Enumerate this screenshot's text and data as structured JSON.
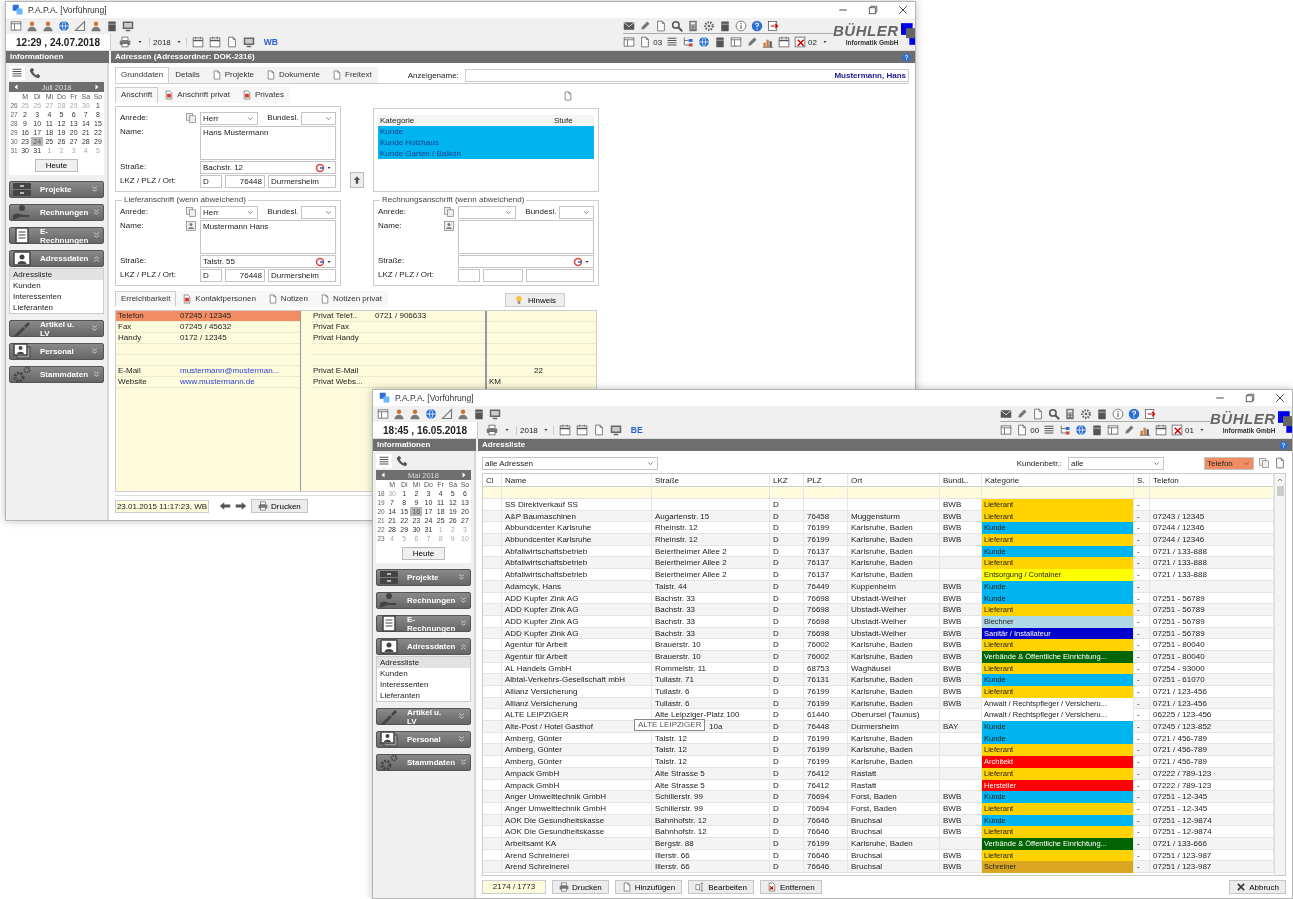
{
  "windows": [
    {
      "kind": "address_form",
      "title": "P.A.P.A. [Vorführung]",
      "clock": "12:29 , 24.07.2018",
      "year": "2018",
      "user": "WB",
      "counter_a": "03",
      "counter_b": "02",
      "logo": {
        "name": "BÜHLER",
        "sub": "Informatik GmbH"
      },
      "side_header": "Informationen",
      "main_header": "Adressen (Adressordner: DOK-2316)",
      "calendar": {
        "month": "Juli 2018",
        "weekdays": [
          "M",
          "Di",
          "Mi",
          "Do",
          "Fr",
          "Sa",
          "So"
        ],
        "weeks": [
          {
            "week": "26",
            "days": [
              {
                "d": "25",
                "muted": true,
                "selected": false
              },
              {
                "d": "26",
                "muted": true,
                "selected": false
              },
              {
                "d": "27",
                "muted": true,
                "selected": false
              },
              {
                "d": "28",
                "muted": true,
                "selected": false
              },
              {
                "d": "29",
                "muted": true,
                "selected": false
              },
              {
                "d": "30",
                "muted": true,
                "selected": false
              },
              {
                "d": "1",
                "muted": false,
                "selected": false
              }
            ]
          },
          {
            "week": "27",
            "days": [
              {
                "d": "2",
                "muted": false,
                "selected": false
              },
              {
                "d": "3",
                "muted": false,
                "selected": false
              },
              {
                "d": "4",
                "muted": false,
                "selected": false
              },
              {
                "d": "5",
                "muted": false,
                "selected": false
              },
              {
                "d": "6",
                "muted": false,
                "selected": false
              },
              {
                "d": "7",
                "muted": false,
                "selected": false
              },
              {
                "d": "8",
                "muted": false,
                "selected": false
              }
            ]
          },
          {
            "week": "28",
            "days": [
              {
                "d": "9",
                "muted": false,
                "selected": false
              },
              {
                "d": "10",
                "muted": false,
                "selected": false
              },
              {
                "d": "11",
                "muted": false,
                "selected": false
              },
              {
                "d": "12",
                "muted": false,
                "selected": false
              },
              {
                "d": "13",
                "muted": false,
                "selected": false
              },
              {
                "d": "14",
                "muted": false,
                "selected": false
              },
              {
                "d": "15",
                "muted": false,
                "selected": false
              }
            ]
          },
          {
            "week": "29",
            "days": [
              {
                "d": "16",
                "muted": false,
                "selected": false
              },
              {
                "d": "17",
                "muted": false,
                "selected": false
              },
              {
                "d": "18",
                "muted": false,
                "selected": false
              },
              {
                "d": "19",
                "muted": false,
                "selected": false
              },
              {
                "d": "20",
                "muted": false,
                "selected": false
              },
              {
                "d": "21",
                "muted": false,
                "selected": false
              },
              {
                "d": "22",
                "muted": false,
                "selected": false
              }
            ]
          },
          {
            "week": "30",
            "days": [
              {
                "d": "23",
                "muted": false,
                "selected": false
              },
              {
                "d": "24",
                "muted": false,
                "selected": true
              },
              {
                "d": "25",
                "muted": false,
                "selected": false
              },
              {
                "d": "26",
                "muted": false,
                "selected": false
              },
              {
                "d": "27",
                "muted": false,
                "selected": false
              },
              {
                "d": "28",
                "muted": false,
                "selected": false
              },
              {
                "d": "29",
                "muted": false,
                "selected": false
              }
            ]
          },
          {
            "week": "31",
            "days": [
              {
                "d": "30",
                "muted": false,
                "selected": false
              },
              {
                "d": "31",
                "muted": false,
                "selected": false
              },
              {
                "d": "1",
                "muted": true,
                "selected": false
              },
              {
                "d": "2",
                "muted": true,
                "selected": false
              },
              {
                "d": "3",
                "muted": true,
                "selected": false
              },
              {
                "d": "4",
                "muted": true,
                "selected": false
              },
              {
                "d": "5",
                "muted": true,
                "selected": false
              }
            ]
          }
        ]
      },
      "today": "Heute",
      "nav": [
        {
          "label": "Projekte",
          "expanded": false
        },
        {
          "label": "Rechnungen",
          "expanded": false
        },
        {
          "label": "E-Rechnungen",
          "expanded": false
        },
        {
          "label": "Adressdaten",
          "expanded": true,
          "items": [
            {
              "label": "Adressliste",
              "selected": true
            },
            {
              "label": "Kunden",
              "selected": false
            },
            {
              "label": "Interessenten",
              "selected": false
            },
            {
              "label": "Lieferanten",
              "selected": false
            }
          ]
        },
        {
          "label": "Artikel u. LV",
          "expanded": false
        },
        {
          "label": "Personal",
          "expanded": false
        },
        {
          "label": "Stammdaten",
          "expanded": false
        }
      ],
      "main": {
        "tabs": [
          {
            "label": "Grunddaten",
            "selected": true,
            "kind": "plain"
          },
          {
            "label": "Details",
            "selected": false,
            "kind": "plain"
          },
          {
            "label": "Projekte",
            "selected": false,
            "kind": "icon"
          },
          {
            "label": "Dokumente",
            "selected": false,
            "kind": "icon"
          },
          {
            "label": "Freitext",
            "selected": false,
            "kind": "icon"
          }
        ],
        "display_name": {
          "label": "Anzeigename:",
          "value": "Mustermann, Hans"
        },
        "subtabs": [
          {
            "label": "Anschrift",
            "selected": true,
            "kind": "plain"
          },
          {
            "label": "Anschrift privat",
            "selected": false,
            "kind": "icon"
          },
          {
            "label": "Privates",
            "selected": false,
            "kind": "icon"
          }
        ],
        "address": {
          "kind": "primary",
          "labels": {
            "salutation": "Anrede:",
            "state": "Bundesl.",
            "name": "Name:",
            "street": "Straße:",
            "location": "LKZ / PLZ / Ort:"
          },
          "salutation": "Herr",
          "name": "Hans Mustermann",
          "street": "Bachstr. 12",
          "country": "D",
          "zip": "76448",
          "city": "Durmersheim"
        },
        "categories": {
          "columns": [
            "Kategorie",
            "Stufe"
          ],
          "rows": [
            {
              "label": "Kunde",
              "selected": true
            },
            {
              "label": "Kunde Holzhaus",
              "selected": true
            },
            {
              "label": "Kunde Garten / Balkon",
              "selected": true
            }
          ]
        },
        "delivery": {
          "kind": "alternate",
          "title": "Lieferanschrift (wenn abweichend)",
          "labels": {
            "salutation": "Anrede:",
            "state": "Bundesl.",
            "name": "Name:",
            "street": "Straße:",
            "location": "LKZ / PLZ / Ort:"
          },
          "salutation": "Herr",
          "name": "Mustermann Hans",
          "street": "Talstr. 55",
          "country": "D",
          "zip": "76448",
          "city": "Durmersheim"
        },
        "billing": {
          "kind": "alternate",
          "title": "Rechnungsanschrift (wenn abweichend)",
          "labels": {
            "salutation": "Anrede:",
            "state": "Bundesl.",
            "name": "Name:",
            "street": "Straße:",
            "location": "LKZ / PLZ / Ort:"
          }
        },
        "contact_tabs": [
          {
            "label": "Erreichbarkeit",
            "selected": true,
            "kind": "plain"
          },
          {
            "label": "Kontaktpersonen",
            "selected": false,
            "kind": "icon"
          },
          {
            "label": "Notizen",
            "selected": false,
            "kind": "icon"
          },
          {
            "label": "Notizen privat",
            "selected": false,
            "kind": "icon"
          }
        ],
        "hint_button": "Hinweis",
        "contacts": [
          {
            "label": "Telefon",
            "value": "07245 / 12345",
            "selected": true,
            "kind": "text",
            "private_label": "Privat Telef..",
            "private_value": "0721 / 906633"
          },
          {
            "label": "Fax",
            "value": "07245 / 45632",
            "selected": false,
            "kind": "text",
            "private_label": "Privat Fax"
          },
          {
            "label": "Handy",
            "value": "0172 / 12345",
            "selected": false,
            "kind": "text",
            "private_label": "Privat Handy"
          },
          {
            "selected": false,
            "kind": "blank"
          },
          {
            "selected": false,
            "kind": "blank"
          },
          {
            "label": "E-Mail",
            "value": "mustermann@musterman...",
            "selected": false,
            "kind": "link",
            "private_label": "Privat E-Mail",
            "extra_value": "22"
          },
          {
            "label": "Website",
            "value": "www.mustermann.de",
            "selected": false,
            "kind": "link",
            "private_label": "Privat Webs...",
            "extra_label": "KM"
          }
        ],
        "footer": {
          "timestamp": "23.01.2015 11:17:23, WB",
          "print": "Drucken"
        }
      }
    },
    {
      "kind": "address_list",
      "title": "P.A.P.A. [Vorführung]",
      "clock": "18:45 , 16.05.2018",
      "year": "2018",
      "user": "BE",
      "counter_a": "00",
      "counter_b": "01",
      "logo": {
        "name": "BÜHLER",
        "sub": "Informatik GmbH"
      },
      "side_header": "Informationen",
      "main_header": "Adressliste",
      "calendar": {
        "month": "Mai 2018",
        "weekdays": [
          "M",
          "Di",
          "Mi",
          "Do",
          "Fr",
          "Sa",
          "So"
        ],
        "weeks": [
          {
            "week": "18",
            "days": [
              {
                "d": "30",
                "muted": true,
                "selected": false
              },
              {
                "d": "1",
                "muted": false,
                "selected": false
              },
              {
                "d": "2",
                "muted": false,
                "selected": false
              },
              {
                "d": "3",
                "muted": false,
                "selected": false
              },
              {
                "d": "4",
                "muted": false,
                "selected": false
              },
              {
                "d": "5",
                "muted": false,
                "selected": false
              },
              {
                "d": "6",
                "muted": false,
                "selected": false
              }
            ]
          },
          {
            "week": "19",
            "days": [
              {
                "d": "7",
                "muted": false,
                "selected": false
              },
              {
                "d": "8",
                "muted": false,
                "selected": false
              },
              {
                "d": "9",
                "muted": false,
                "selected": false
              },
              {
                "d": "10",
                "muted": false,
                "selected": false
              },
              {
                "d": "11",
                "muted": false,
                "selected": false
              },
              {
                "d": "12",
                "muted": false,
                "selected": false
              },
              {
                "d": "13",
                "muted": false,
                "selected": false
              }
            ]
          },
          {
            "week": "20",
            "days": [
              {
                "d": "14",
                "muted": false,
                "selected": false
              },
              {
                "d": "15",
                "muted": false,
                "selected": false
              },
              {
                "d": "16",
                "muted": false,
                "selected": true
              },
              {
                "d": "17",
                "muted": false,
                "selected": false
              },
              {
                "d": "18",
                "muted": false,
                "selected": false
              },
              {
                "d": "19",
                "muted": false,
                "selected": false
              },
              {
                "d": "20",
                "muted": false,
                "selected": false
              }
            ]
          },
          {
            "week": "21",
            "days": [
              {
                "d": "21",
                "muted": false,
                "selected": false
              },
              {
                "d": "22",
                "muted": false,
                "selected": false
              },
              {
                "d": "23",
                "muted": false,
                "selected": false
              },
              {
                "d": "24",
                "muted": false,
                "selected": false
              },
              {
                "d": "25",
                "muted": false,
                "selected": false
              },
              {
                "d": "26",
                "muted": false,
                "selected": false
              },
              {
                "d": "27",
                "muted": false,
                "selected": false
              }
            ]
          },
          {
            "week": "22",
            "days": [
              {
                "d": "28",
                "muted": false,
                "selected": false
              },
              {
                "d": "29",
                "muted": false,
                "selected": false
              },
              {
                "d": "30",
                "muted": false,
                "selected": false
              },
              {
                "d": "31",
                "muted": false,
                "selected": false
              },
              {
                "d": "1",
                "muted": true,
                "selected": false
              },
              {
                "d": "2",
                "muted": true,
                "selected": false
              },
              {
                "d": "3",
                "muted": true,
                "selected": false
              }
            ]
          },
          {
            "week": "23",
            "days": [
              {
                "d": "4",
                "muted": true,
                "selected": false
              },
              {
                "d": "5",
                "muted": true,
                "selected": false
              },
              {
                "d": "6",
                "muted": true,
                "selected": false
              },
              {
                "d": "7",
                "muted": true,
                "selected": false
              },
              {
                "d": "8",
                "muted": true,
                "selected": false
              },
              {
                "d": "9",
                "muted": true,
                "selected": false
              },
              {
                "d": "10",
                "muted": true,
                "selected": false
              }
            ]
          }
        ]
      },
      "today": "Heute",
      "nav": [
        {
          "label": "Projekte",
          "expanded": false
        },
        {
          "label": "Rechnungen",
          "expanded": false
        },
        {
          "label": "E-Rechnungen",
          "expanded": false
        },
        {
          "label": "Adressdaten",
          "expanded": true,
          "items": [
            {
              "label": "Adressliste",
              "selected": true
            },
            {
              "label": "Kunden",
              "selected": false
            },
            {
              "label": "Interessenten",
              "selected": false
            },
            {
              "label": "Lieferanten",
              "selected": false
            }
          ]
        },
        {
          "label": "Artikel u. LV",
          "expanded": false
        },
        {
          "label": "Personal",
          "expanded": false
        },
        {
          "label": "Stammdaten",
          "expanded": false
        }
      ],
      "main": {
        "filter": "alle Adressen",
        "customer_label": "Kundenbetr.:",
        "customer": "alle",
        "column_select": "Telefon",
        "columns": [
          "Cl",
          "Name",
          "Straße",
          "LKZ",
          "PLZ",
          "Ort",
          "BundL.",
          "Kategorie",
          "S.",
          "Telefon"
        ],
        "rows": [
          {
            "name": "SS Direktverkauf SS",
            "lkz": "D",
            "state": "BWB",
            "category": "Lieferant",
            "color": "#ffd200",
            "s": "-"
          },
          {
            "name": "A&P Baumaschinen",
            "street": "Augartenstr. 15",
            "lkz": "D",
            "plz": "76458",
            "city": "Muggensturm",
            "state": "BWB",
            "category": "Lieferant",
            "color": "#ffd200",
            "s": "-",
            "phone": "07243 / 12345"
          },
          {
            "name": "Abbundcenter Karlsruhe",
            "street": "Rheinstr. 12",
            "lkz": "D",
            "plz": "76199",
            "city": "Karlsruhe, Baden",
            "state": "BWB",
            "category": "Kunde",
            "color": "#00b4f0",
            "s": "-",
            "phone": "07244 / 12346"
          },
          {
            "name": "Abbundcenter Karlsruhe",
            "street": "Rheinstr. 12",
            "lkz": "D",
            "plz": "76199",
            "city": "Karlsruhe, Baden",
            "state": "BWB",
            "category": "Lieferant",
            "color": "#ffd200",
            "s": "-",
            "phone": "07244 / 12346"
          },
          {
            "name": "Abfallwirtschaftsbetrieb",
            "street": "Beiertheimer Allee 2",
            "lkz": "D",
            "plz": "76137",
            "city": "Karlsruhe, Baden",
            "category": "Kunde",
            "color": "#00b4f0",
            "s": "-",
            "phone": "0721 / 133-888"
          },
          {
            "name": "Abfallwirtschaftsbetrieb",
            "street": "Beiertheimer Allee 2",
            "lkz": "D",
            "plz": "76137",
            "city": "Karlsruhe, Baden",
            "category": "Lieferant",
            "color": "#ffd200",
            "s": "-",
            "phone": "0721 / 133-888"
          },
          {
            "name": "Abfallwirtschaftsbetrieb",
            "street": "Beiertheimer Allee 2",
            "lkz": "D",
            "plz": "76137",
            "city": "Karlsruhe, Baden",
            "category": "Entsorgung / Container",
            "color": "#ffff00",
            "s": "-",
            "phone": "0721 / 133-888"
          },
          {
            "name": "Adamcyk, Hans",
            "street": "Talstr. 44",
            "lkz": "D",
            "plz": "76449",
            "city": "Kuppenheim",
            "state": "BWB",
            "category": "Kunde",
            "color": "#00b4f0",
            "s": "-"
          },
          {
            "name": "ADD Kupfer Zink AG",
            "street": "Bachstr. 33",
            "lkz": "D",
            "plz": "76698",
            "city": "Ubstadt-Weiher",
            "state": "BWB",
            "category": "Kunde",
            "color": "#00b4f0",
            "s": "-",
            "phone": "07251 - 56789"
          },
          {
            "name": "ADD Kupfer Zink AG",
            "street": "Bachstr. 33",
            "lkz": "D",
            "plz": "76698",
            "city": "Ubstadt-Weiher",
            "state": "BWB",
            "category": "Lieferant",
            "color": "#ffd200",
            "s": "-",
            "phone": "07251 - 56789"
          },
          {
            "name": "ADD Kupfer Zink AG",
            "street": "Bachstr. 33",
            "lkz": "D",
            "plz": "76698",
            "city": "Ubstadt-Weiher",
            "state": "BWB",
            "category": "Blechner",
            "color": "#add8e6",
            "s": "-",
            "phone": "07251 - 56789"
          },
          {
            "name": "ADD Kupfer Zink AG",
            "street": "Bachstr. 33",
            "lkz": "D",
            "plz": "76698",
            "city": "Ubstadt-Weiher",
            "state": "BWB",
            "category": "Sanitär / Installateur",
            "color": "#0000cd",
            "s": "-",
            "phone": "07251 - 56789"
          },
          {
            "name": "Agentur für Arbeit",
            "street": "Brauerstr. 10",
            "lkz": "D",
            "plz": "76002",
            "city": "Karlsruhe, Baden",
            "state": "BWB",
            "category": "Lieferant",
            "color": "#ffd200",
            "s": "-",
            "phone": "07251 - 80040"
          },
          {
            "name": "Agentur für Arbeit",
            "street": "Brauerstr. 10",
            "lkz": "D",
            "plz": "76002",
            "city": "Karlsruhe, Baden",
            "state": "BWB",
            "category": "Verbände & Öffentliche Einrichtung...",
            "color": "#006400",
            "s": "-",
            "phone": "07251 - 80040"
          },
          {
            "name": "AL Handels GmbH",
            "street": "Rommelstr. 11",
            "lkz": "D",
            "plz": "68753",
            "city": "Waghäusel",
            "state": "BWB",
            "category": "Lieferant",
            "color": "#ffd200",
            "s": "-",
            "phone": "07254 - 93000"
          },
          {
            "name": "Albtal-Verkehrs-Gesellschaft mbH",
            "street": "Tullastr. 71",
            "lkz": "D",
            "plz": "76131",
            "city": "Karlsruhe, Baden",
            "state": "BWB",
            "category": "Kunde",
            "color": "#00b4f0",
            "s": "-",
            "phone": "07251 - 61070"
          },
          {
            "name": "Allianz Versicherung",
            "street": "Tullastr. 6",
            "lkz": "D",
            "plz": "76199",
            "city": "Karlsruhe, Baden",
            "state": "BWB",
            "category": "Lieferant",
            "color": "#ffd200",
            "s": "-",
            "phone": "0721 / 123-456"
          },
          {
            "name": "Allianz Versicherung",
            "street": "Tullastr. 6",
            "lkz": "D",
            "plz": "76199",
            "city": "Karlsruhe, Baden",
            "state": "BWB",
            "category": "Anwalt / Rechtspfleger / Versicheru...",
            "color": "#ffffff",
            "s": "-",
            "phone": "0721 / 123-456"
          },
          {
            "name": "ALTE LEIPZIGER",
            "street": "Alte Leipziger-Platz 100",
            "lkz": "D",
            "plz": "61440",
            "city": "Oberursel (Taunus)",
            "category": "Anwalt / Rechtspfleger / Versicheru...",
            "color": "#ffffff",
            "s": "-",
            "phone": "06225 / 123-456"
          },
          {
            "name": "Alte-Post / Hotel Gasthof",
            "tooltip": "ALTE LEIPZIGER",
            "street": "10a",
            "lkz": "D",
            "plz": "76448",
            "city": "Durmersheim",
            "state": "BAY",
            "category": "Kunde",
            "color": "#00b4f0",
            "s": "-",
            "phone": "07245 / 123-852"
          },
          {
            "name": "Amberg, Günter",
            "street": "Talstr. 12",
            "lkz": "D",
            "plz": "76199",
            "city": "Karlsruhe, Baden",
            "category": "Kunde",
            "color": "#00b4f0",
            "s": "-",
            "phone": "0721 / 456-789"
          },
          {
            "name": "Amberg, Günter",
            "street": "Talstr. 12",
            "lkz": "D",
            "plz": "76199",
            "city": "Karlsruhe, Baden",
            "category": "Lieferant",
            "color": "#ffd200",
            "s": "-",
            "phone": "0721 / 456-789"
          },
          {
            "name": "Amberg, Günter",
            "street": "Talstr. 12",
            "lkz": "D",
            "plz": "76199",
            "city": "Karlsruhe, Baden",
            "category": "Architekt",
            "color": "#ff0000",
            "s": "-",
            "phone": "0721 / 456-789"
          },
          {
            "name": "Ampack GmbH",
            "street": "Alte Strasse 5",
            "lkz": "D",
            "plz": "76412",
            "city": "Rastatt",
            "category": "Lieferant",
            "color": "#ffd200",
            "s": "-",
            "phone": "07222 / 789-123"
          },
          {
            "name": "Ampack GmbH",
            "street": "Alte Strasse 5",
            "lkz": "D",
            "plz": "76412",
            "city": "Rastatt",
            "category": "Hersteller",
            "color": "#ff0000",
            "s": "-",
            "phone": "07222 / 789-123"
          },
          {
            "name": "Anger Umwelttechnik GmbH",
            "street": "Schillerstr. 99",
            "lkz": "D",
            "plz": "76694",
            "city": "Forst, Baden",
            "state": "BWB",
            "category": "Kunde",
            "color": "#00b4f0",
            "s": "-",
            "phone": "07251 - 12-345"
          },
          {
            "name": "Anger Umwelttechnik GmbH",
            "street": "Schillerstr. 99",
            "lkz": "D",
            "plz": "76694",
            "city": "Forst, Baden",
            "state": "BWB",
            "category": "Lieferant",
            "color": "#ffd200",
            "s": "-",
            "phone": "07251 - 12-345"
          },
          {
            "name": "AOK Die Gesundheitskasse",
            "street": "Bahnhofstr. 12",
            "lkz": "D",
            "plz": "76646",
            "city": "Bruchsal",
            "state": "BWB",
            "category": "Kunde",
            "color": "#00b4f0",
            "s": "-",
            "phone": "07251 - 12-9874"
          },
          {
            "name": "AOK Die Gesundheitskasse",
            "street": "Bahnhofstr. 12",
            "lkz": "D",
            "plz": "76646",
            "city": "Bruchsal",
            "state": "BWB",
            "category": "Lieferant",
            "color": "#ffd200",
            "s": "-",
            "phone": "07251 - 12-9874"
          },
          {
            "name": "Arbeitsamt KA",
            "street": "Bergstr. 88",
            "lkz": "D",
            "plz": "76199",
            "city": "Karlsruhe, Baden",
            "category": "Verbände & Öffentliche Einrichtung...",
            "color": "#006400",
            "s": "-",
            "phone": "0721 / 133-666"
          },
          {
            "name": "Arend Schreinerei",
            "street": "Illerstr. 66",
            "lkz": "D",
            "plz": "76646",
            "city": "Bruchsal",
            "state": "BWB",
            "category": "Lieferant",
            "color": "#ffd200",
            "s": "-",
            "phone": "07251 / 123-987"
          },
          {
            "name": "Arend Schreinerei",
            "street": "Illerstr. 66",
            "lkz": "D",
            "plz": "76646",
            "city": "Bruchsal",
            "state": "BWB",
            "category": "Schreiner",
            "color": "#daa520",
            "s": "-",
            "phone": "07251 / 123-987"
          }
        ],
        "footer": {
          "count": "2174 / 1773",
          "buttons": [
            {
              "label": "Drucken",
              "kind": "print"
            },
            {
              "label": "Hinzufügen",
              "kind": "add"
            },
            {
              "label": "Bearbeiten",
              "kind": "edit"
            },
            {
              "label": "Entfernen",
              "kind": "delete"
            }
          ],
          "cancel": "Abbruch"
        }
      }
    }
  ]
}
